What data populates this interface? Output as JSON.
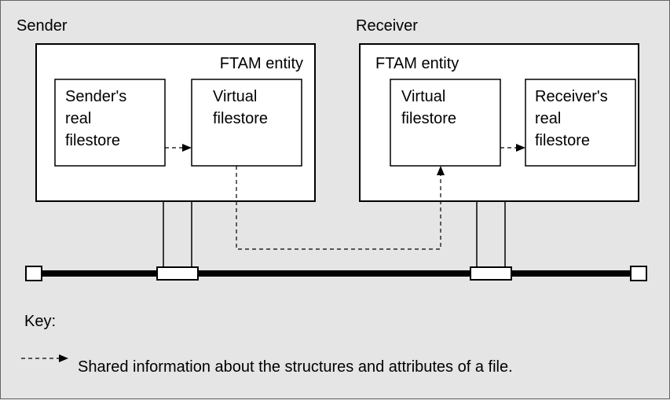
{
  "sender": {
    "label": "Sender",
    "entity": "FTAM entity",
    "realFilestore": {
      "l1": "Sender's",
      "l2": "real",
      "l3": "filestore"
    },
    "virtualFilestore": {
      "l1": "Virtual",
      "l2": "filestore"
    }
  },
  "receiver": {
    "label": "Receiver",
    "entity": "FTAM entity",
    "virtualFilestore": {
      "l1": "Virtual",
      "l2": "filestore"
    },
    "realFilestore": {
      "l1": "Receiver's",
      "l2": "real",
      "l3": "filestore"
    }
  },
  "key": {
    "heading": "Key:",
    "arrowDesc": "Shared information about the structures and attributes of a file."
  }
}
